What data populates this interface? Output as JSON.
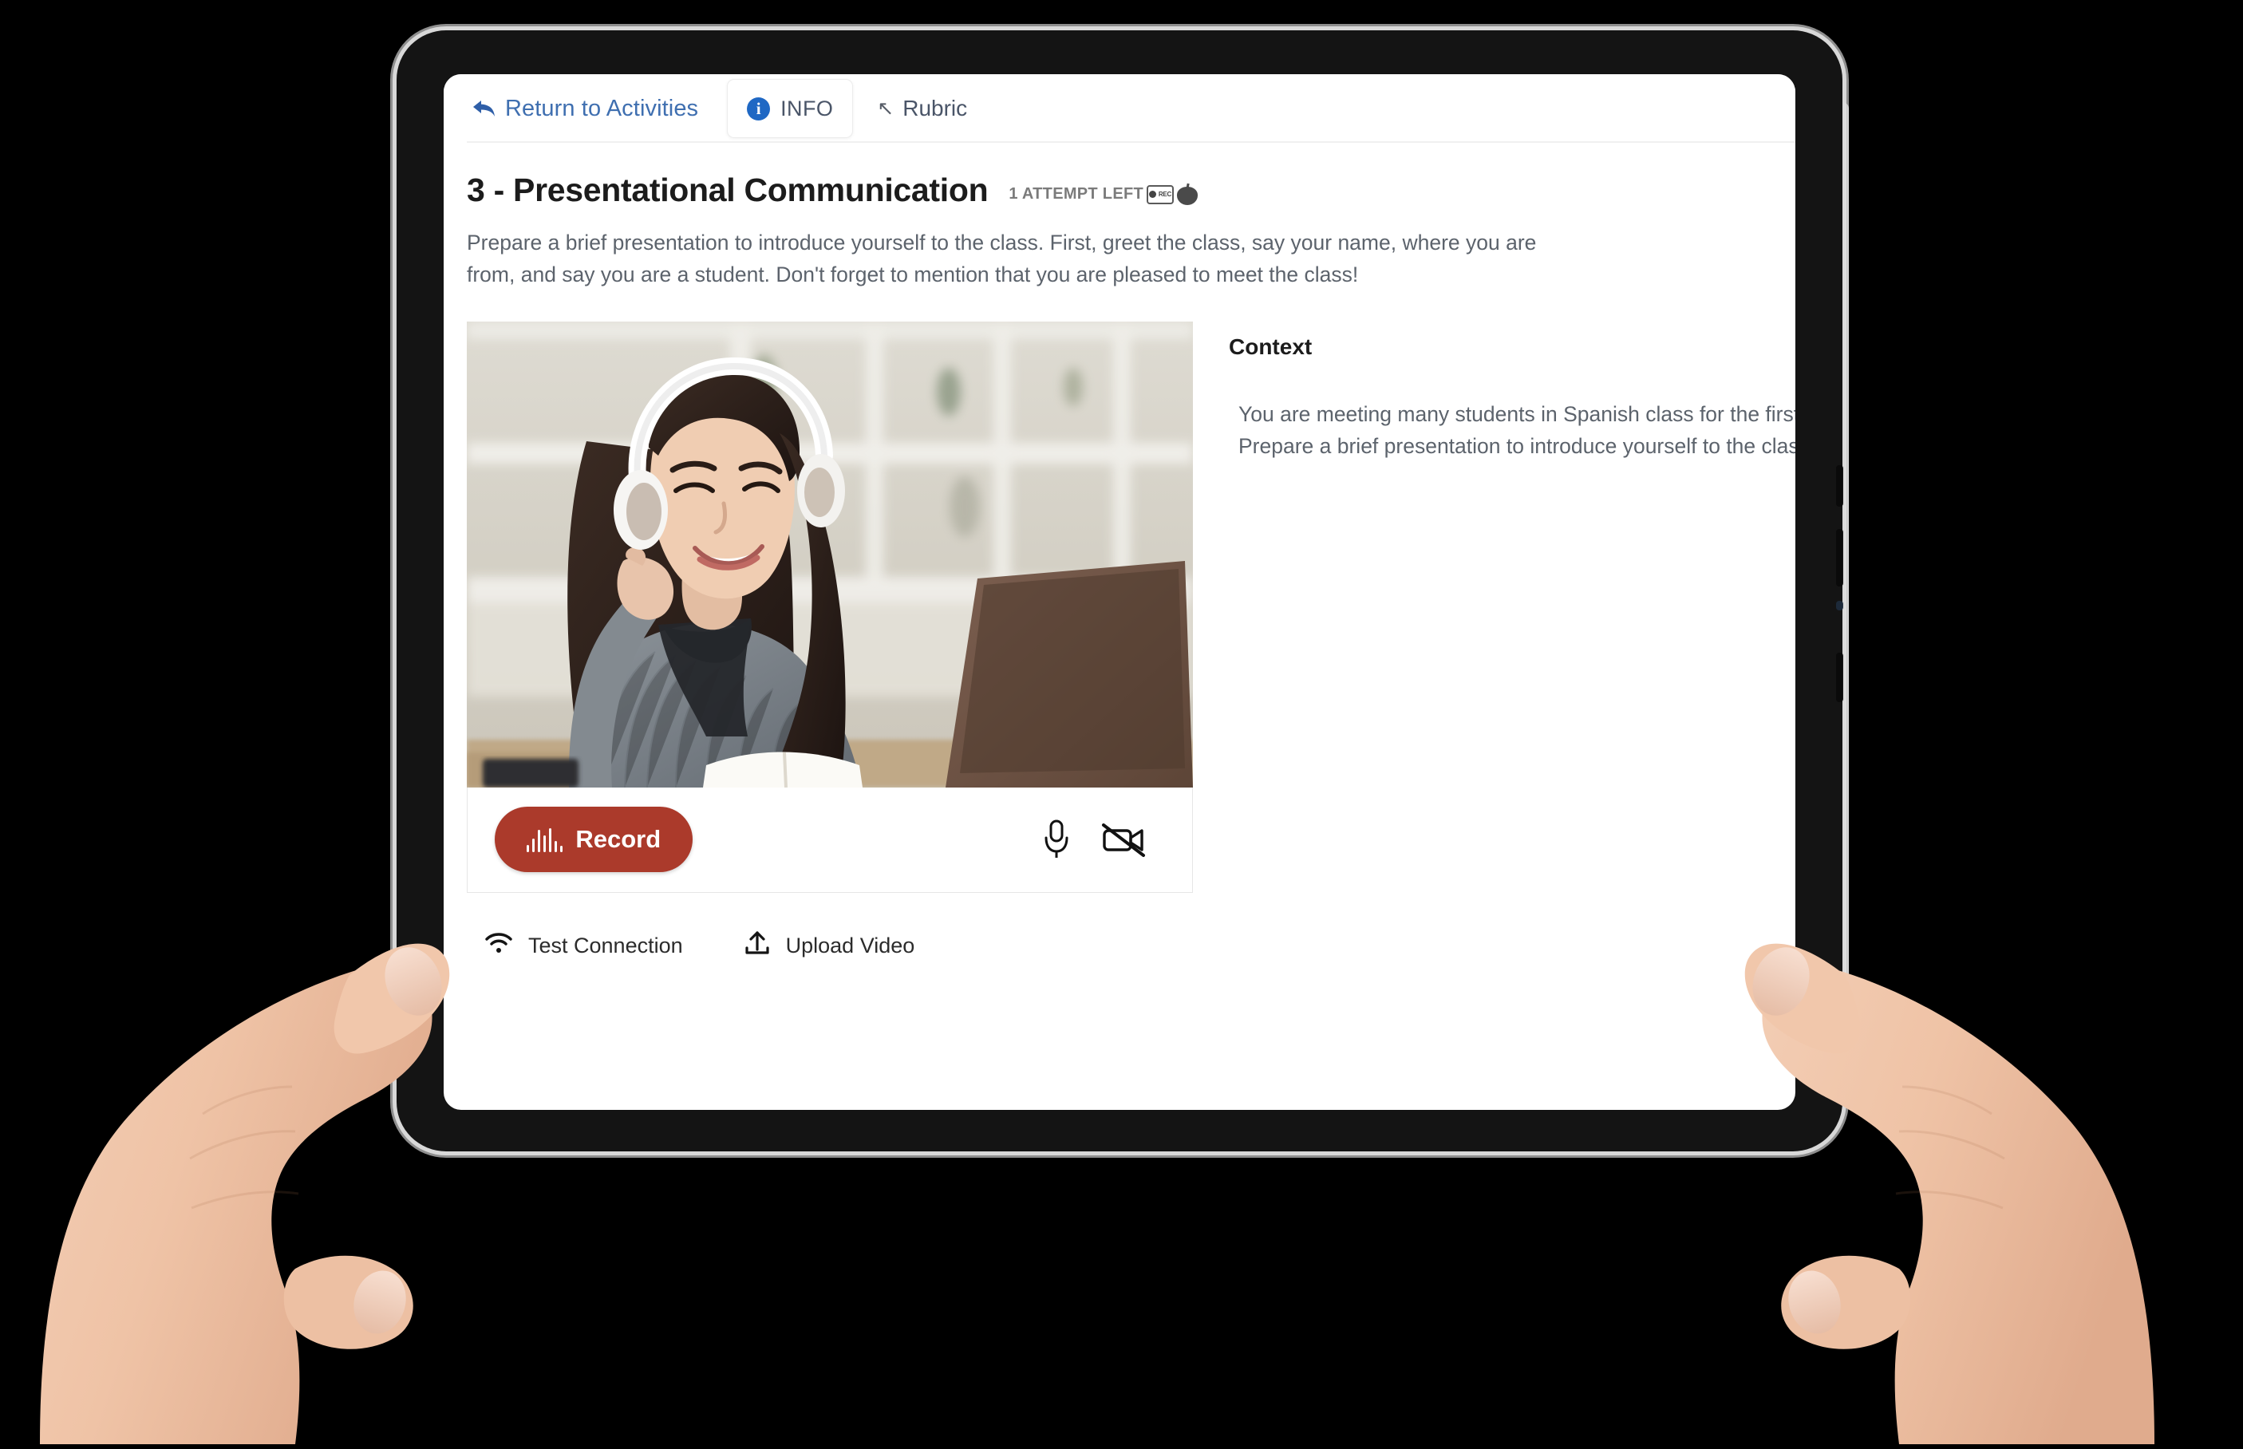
{
  "tabbar": {
    "return_link": "Return to Activities",
    "back_arrow_icon": "↰",
    "info_tab": "INFO",
    "info_icon_glyph": "i",
    "rubric_tab": "Rubric",
    "rubric_icon": "↖"
  },
  "activity": {
    "title": "3 - Presentational Communication",
    "attempts_left": "1 ATTEMPT LEFT",
    "recording_badge_text": "REC",
    "instructions": "Prepare a brief presentation to introduce yourself to the class. First, greet the class, say your name, where you are from, and say you are a student. Don't forget to mention that you are pleased to meet the class!"
  },
  "context": {
    "heading": "Context",
    "body": "You are meeting many students in Spanish class for the first time. Prepare a brief presentation to introduce yourself to the class."
  },
  "recorder": {
    "record_button_label": "Record",
    "microphone_icon": "microphone-icon",
    "camera_off_icon": "camera-off-icon",
    "test_connection_label": "Test Connection",
    "upload_video_label": "Upload Video",
    "wifi_icon": "wifi-icon",
    "upload_icon": "upload-icon"
  },
  "colors": {
    "record_red": "#ab3a2b",
    "link_blue": "#3f6fb0",
    "info_badge_blue": "#1f68c4",
    "body_text": "#5c636c",
    "device_black": "#141414"
  }
}
